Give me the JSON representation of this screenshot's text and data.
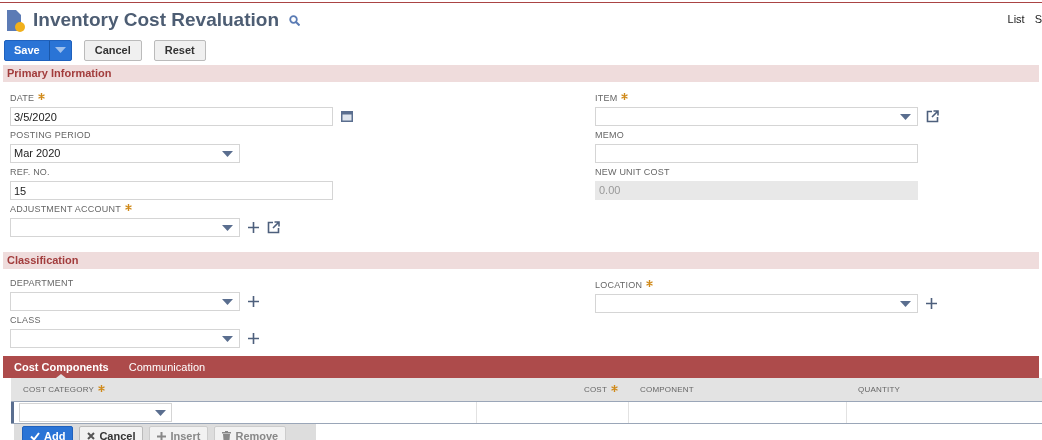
{
  "page": {
    "title": "Inventory Cost Revaluation",
    "nav_links": [
      "List",
      "S"
    ]
  },
  "buttons": [
    {
      "label": "Save",
      "kind": "primary"
    },
    {
      "label": "Cancel",
      "kind": "plain"
    },
    {
      "label": "Reset",
      "kind": "plain"
    }
  ],
  "sections": [
    {
      "title": "Primary Information",
      "columns": [
        [
          {
            "label": "DATE",
            "kind": "date",
            "required": true,
            "value": "3/5/2020"
          },
          {
            "label": "POSTING PERIOD",
            "kind": "select",
            "required": false,
            "value": "Mar 2020"
          },
          {
            "label": "REF. NO.",
            "kind": "text",
            "required": false,
            "value": "15"
          },
          {
            "label": "ADJUSTMENT ACCOUNT",
            "kind": "select",
            "required": true,
            "add": true,
            "open": true
          }
        ],
        [
          {
            "label": "ITEM",
            "kind": "select",
            "required": true,
            "add": false,
            "open": true
          },
          {
            "label": "MEMO",
            "kind": "text",
            "required": false
          },
          {
            "label": "NEW UNIT COST",
            "kind": "readonly",
            "required": false,
            "value": "0.00"
          }
        ]
      ]
    },
    {
      "title": "Classification",
      "columns": [
        [
          {
            "label": "DEPARTMENT",
            "kind": "select",
            "required": false,
            "add": true,
            "open": false
          },
          {
            "label": "CLASS",
            "kind": "select",
            "required": false,
            "add": true,
            "open": false
          }
        ],
        [
          {
            "label": "LOCATION",
            "kind": "select",
            "required": true,
            "add": true,
            "open": false
          }
        ]
      ]
    }
  ],
  "tabs": [
    {
      "label": "Cost Components",
      "selected": true
    },
    {
      "label": "Communication",
      "selected": false
    }
  ],
  "table": {
    "columns": [
      {
        "label": "COST CATEGORY",
        "required": true
      },
      {
        "label": "COST",
        "required": true
      },
      {
        "label": "COMPONENT",
        "required": false
      },
      {
        "label": "QUANTITY",
        "required": false
      }
    ]
  },
  "row_buttons": [
    {
      "label": "Add",
      "kind": "primary",
      "disabled": false
    },
    {
      "label": "Cancel",
      "kind": "plain",
      "disabled": false
    },
    {
      "label": "Insert",
      "kind": "plain",
      "disabled": true
    },
    {
      "label": "Remove",
      "kind": "plain",
      "disabled": true
    }
  ]
}
